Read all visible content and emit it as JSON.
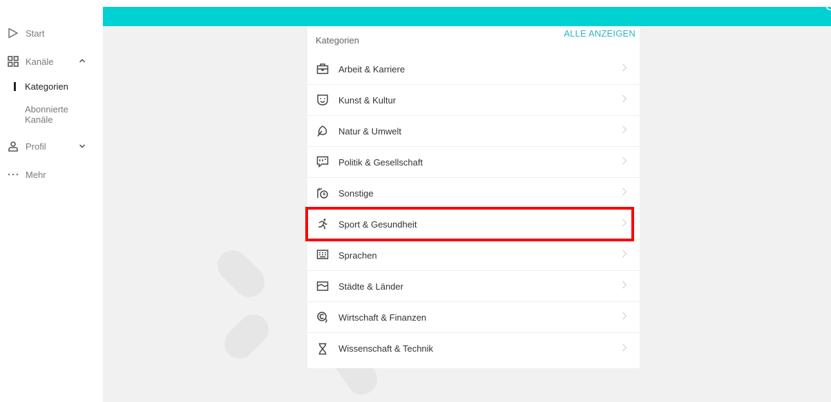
{
  "sidebar": {
    "start": "Start",
    "kanaele": "Kanäle",
    "kategorien": "Kategorien",
    "abonnierte_line1": "Abonnierte",
    "abonnierte_line2": "Kanäle",
    "profil": "Profil",
    "mehr": "Mehr"
  },
  "panel": {
    "title": "Kategorien",
    "show_all": "ALLE ANZEIGEN"
  },
  "categories": [
    {
      "label": "Arbeit & Karriere",
      "icon": "briefcase-icon"
    },
    {
      "label": "Kunst & Kultur",
      "icon": "theater-mask-icon"
    },
    {
      "label": "Natur & Umwelt",
      "icon": "leaf-icon"
    },
    {
      "label": "Politik & Gesellschaft",
      "icon": "speech-bubble-icon"
    },
    {
      "label": "Sonstige",
      "icon": "misc-clock-icon"
    },
    {
      "label": "Sport & Gesundheit",
      "icon": "running-person-icon"
    },
    {
      "label": "Sprachen",
      "icon": "keyboard-icon"
    },
    {
      "label": "Städte & Länder",
      "icon": "flag-map-icon"
    },
    {
      "label": "Wirtschaft & Finanzen",
      "icon": "coin-icon"
    },
    {
      "label": "Wissenschaft & Technik",
      "icon": "hourglass-icon"
    }
  ],
  "colors": {
    "accent": "#00d2d3",
    "link": "#24b8c4",
    "highlight": "#ff0000"
  }
}
